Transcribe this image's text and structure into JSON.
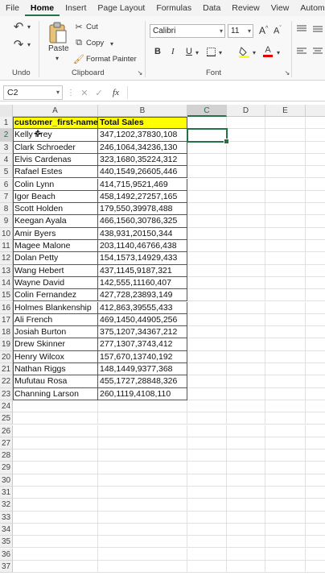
{
  "menu": [
    "File",
    "Home",
    "Insert",
    "Page Layout",
    "Formulas",
    "Data",
    "Review",
    "View",
    "Autom"
  ],
  "ribbon": {
    "undo_label": "Undo",
    "paste_label": "Paste",
    "cut_label": "Cut",
    "copy_label": "Copy",
    "format_painter_label": "Format Painter",
    "clipboard_label": "Clipboard",
    "font_name": "Calibri",
    "font_size": "11",
    "font_label": "Font",
    "bold": "B",
    "italic": "I",
    "underline": "U",
    "grow_font": "A",
    "shrink_font": "A",
    "font_color_letter": "A"
  },
  "formula_bar": {
    "name_box": "C2",
    "fx": "fx",
    "value": ""
  },
  "columns": [
    "A",
    "B",
    "C",
    "D",
    "E"
  ],
  "selected_column": "C",
  "selected_row": 2,
  "table": {
    "headers": [
      "customer_first-name",
      "Total Sales"
    ],
    "rows": [
      [
        "Kelly Frey",
        "347,1202,37830,108"
      ],
      [
        "Clark Schroeder",
        "246,1064,34236,130"
      ],
      [
        "Elvis Cardenas",
        "323,1680,35224,312"
      ],
      [
        "Rafael Estes",
        "440,1549,26605,446"
      ],
      [
        "Colin Lynn",
        "414,715,9521,469"
      ],
      [
        "Igor Beach",
        "458,1492,27257,165"
      ],
      [
        "Scott Holden",
        "179,550,39978,488"
      ],
      [
        "Keegan Ayala",
        "466,1560,30786,325"
      ],
      [
        "Amir Byers",
        "438,931,20150,344"
      ],
      [
        "Magee Malone",
        "203,1140,46766,438"
      ],
      [
        "Dolan Petty",
        "154,1573,14929,433"
      ],
      [
        "Wang Hebert",
        "437,1145,9187,321"
      ],
      [
        "Wayne David",
        "142,555,11160,407"
      ],
      [
        "Colin Fernandez",
        "427,728,23893,149"
      ],
      [
        "Holmes Blankenship",
        "412,863,39555,433"
      ],
      [
        "Ali French",
        "469,1450,44905,256"
      ],
      [
        "Josiah Burton",
        "375,1207,34367,212"
      ],
      [
        "Drew Skinner",
        "277,1307,3743,412"
      ],
      [
        "Henry Wilcox",
        "157,670,13740,192"
      ],
      [
        "Nathan Riggs",
        "148,1449,9377,368"
      ],
      [
        "Mufutau Rosa",
        "455,1727,28848,326"
      ],
      [
        "Channing Larson",
        "260,1119,4108,110"
      ]
    ]
  },
  "total_rows": 37,
  "colors": {
    "accent": "#217346",
    "header_fill": "#ffff00"
  }
}
